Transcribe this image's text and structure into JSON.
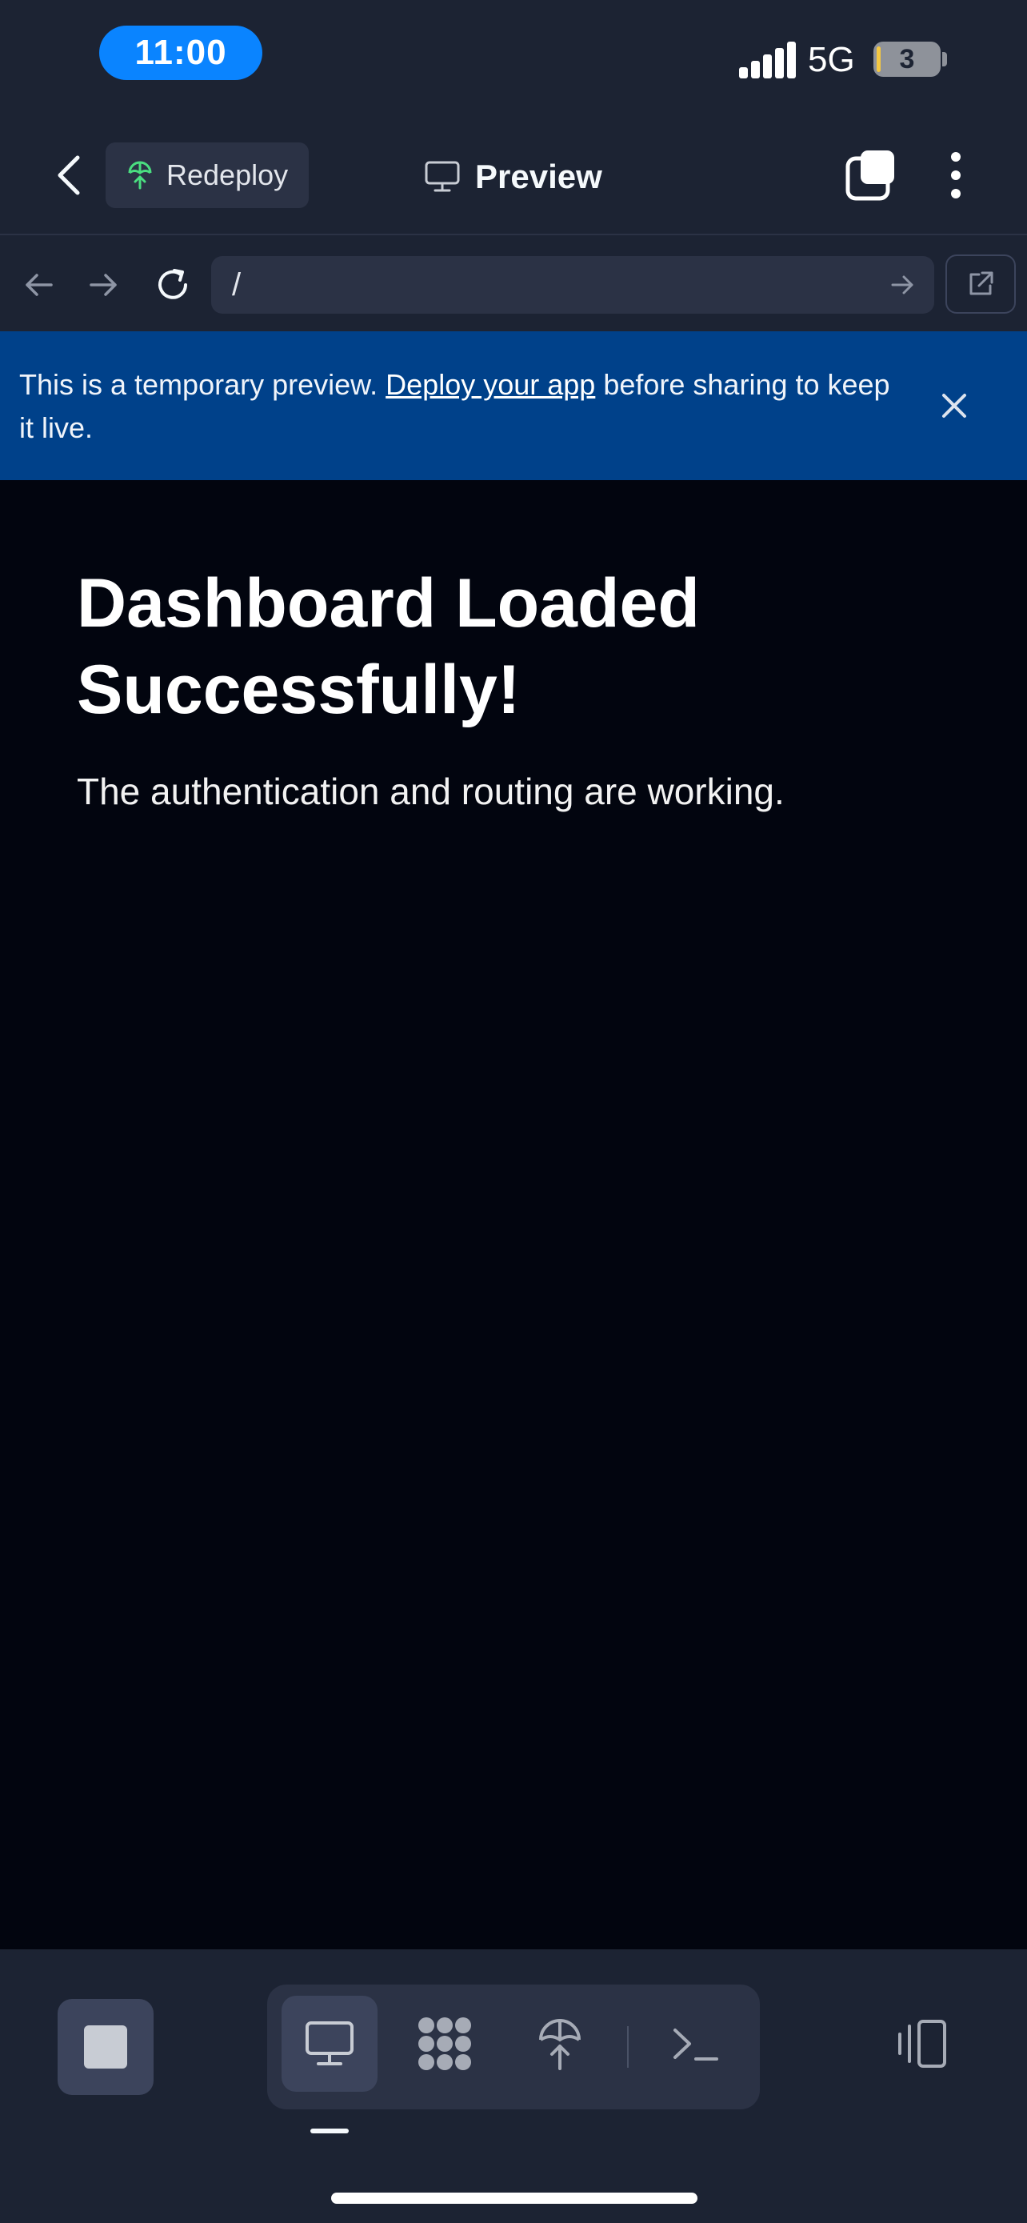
{
  "status_bar": {
    "time": "11:00",
    "network": "5G",
    "battery": "3"
  },
  "header": {
    "redeploy_label": "Redeploy",
    "title": "Preview"
  },
  "browser": {
    "url": "/"
  },
  "banner": {
    "text_before": "This is a temporary preview. ",
    "link": "Deploy your app",
    "text_after": " before sharing to keep it live."
  },
  "preview": {
    "heading": "Dashboard Loaded Successfully!",
    "subtext": "The authentication and routing are working."
  },
  "colors": {
    "background": "#1c2333",
    "banner": "#00418a",
    "content_bg": "#02050f",
    "time_pill": "#0a84ff",
    "accent_green": "#4ade80"
  },
  "bottom_tools": [
    "monitor-icon",
    "apps-grid-icon",
    "deploy-icon",
    "terminal-icon"
  ]
}
